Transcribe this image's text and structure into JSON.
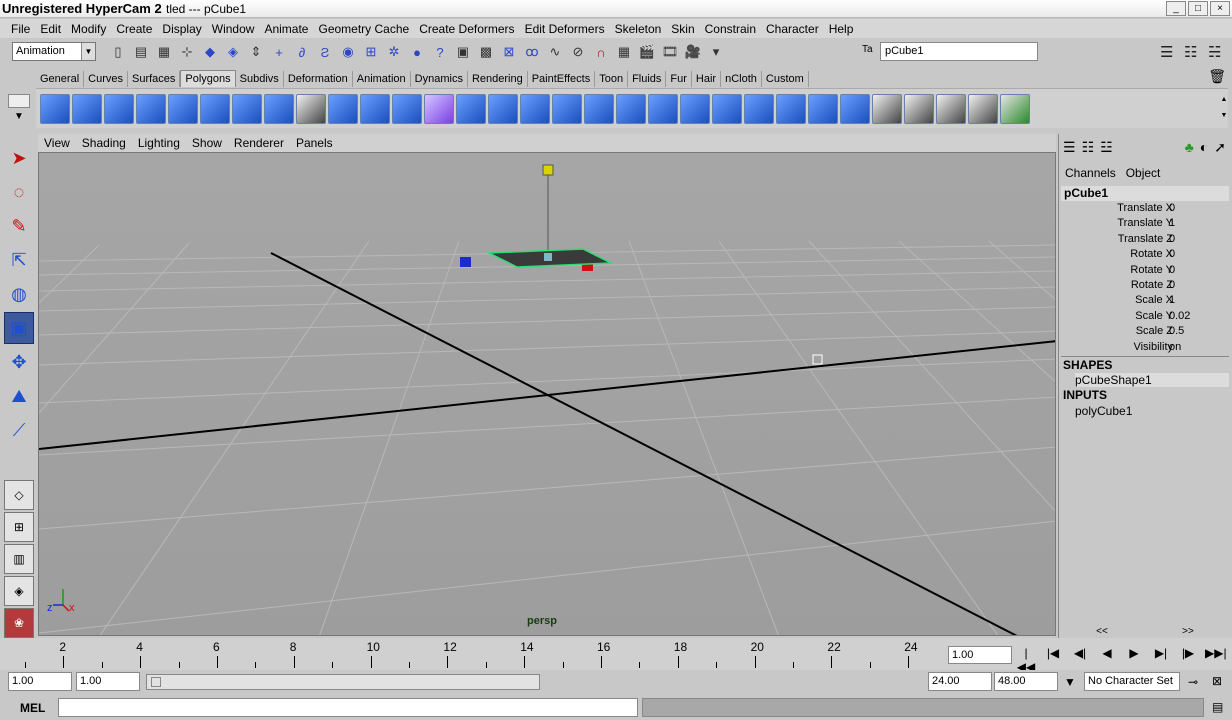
{
  "window": {
    "title": "Unregistered HyperCam 2",
    "title_tail": "tled  ---  pCube1"
  },
  "menu": [
    "File",
    "Edit",
    "Modify",
    "Create",
    "Display",
    "Window",
    "Animate",
    "Geometry Cache",
    "Create Deformers",
    "Edit Deformers",
    "Skeleton",
    "Skin",
    "Constrain",
    "Character",
    "Help"
  ],
  "status": {
    "mode": "Animation",
    "object_name": "pCube1"
  },
  "shelf_tabs": [
    "General",
    "Curves",
    "Surfaces",
    "Polygons",
    "Subdivs",
    "Deformation",
    "Animation",
    "Dynamics",
    "Rendering",
    "PaintEffects",
    "Toon",
    "Fluids",
    "Fur",
    "Hair",
    "nCloth",
    "Custom"
  ],
  "shelf_active_tab": "Polygons",
  "panel_menu": [
    "View",
    "Shading",
    "Lighting",
    "Show",
    "Renderer",
    "Panels"
  ],
  "viewport": {
    "camera": "persp",
    "axis_x": "x",
    "axis_z": "z"
  },
  "channel_box": {
    "tabs": [
      "Channels",
      "Object"
    ],
    "object": "pCube1",
    "attributes": [
      {
        "name": "Translate X",
        "value": "0"
      },
      {
        "name": "Translate Y",
        "value": "1"
      },
      {
        "name": "Translate Z",
        "value": "0"
      },
      {
        "name": "Rotate X",
        "value": "0"
      },
      {
        "name": "Rotate Y",
        "value": "0"
      },
      {
        "name": "Rotate Z",
        "value": "0"
      },
      {
        "name": "Scale X",
        "value": "1"
      },
      {
        "name": "Scale Y",
        "value": "0.02"
      },
      {
        "name": "Scale Z",
        "value": "0.5"
      },
      {
        "name": "Visibility",
        "value": "on"
      }
    ],
    "shapes_header": "SHAPES",
    "shape": "pCubeShape1",
    "inputs_header": "INPUTS",
    "input": "polyCube1",
    "scroll_left": "<<",
    "scroll_right": ">>"
  },
  "timeline": {
    "labels": [
      "2",
      "4",
      "6",
      "8",
      "10",
      "12",
      "14",
      "16",
      "18",
      "20",
      "22",
      "24"
    ],
    "current_frame": "1.00",
    "playback": [
      "|◀◀",
      "|◀",
      "◀|",
      "◀",
      "▶",
      "▶|",
      "|▶",
      "▶▶|"
    ]
  },
  "range": {
    "start": "1.00",
    "playback_start": "1.00",
    "playback_end": "24.00",
    "end": "48.00",
    "character_set": "No Character Set"
  },
  "command": {
    "label": "MEL"
  }
}
